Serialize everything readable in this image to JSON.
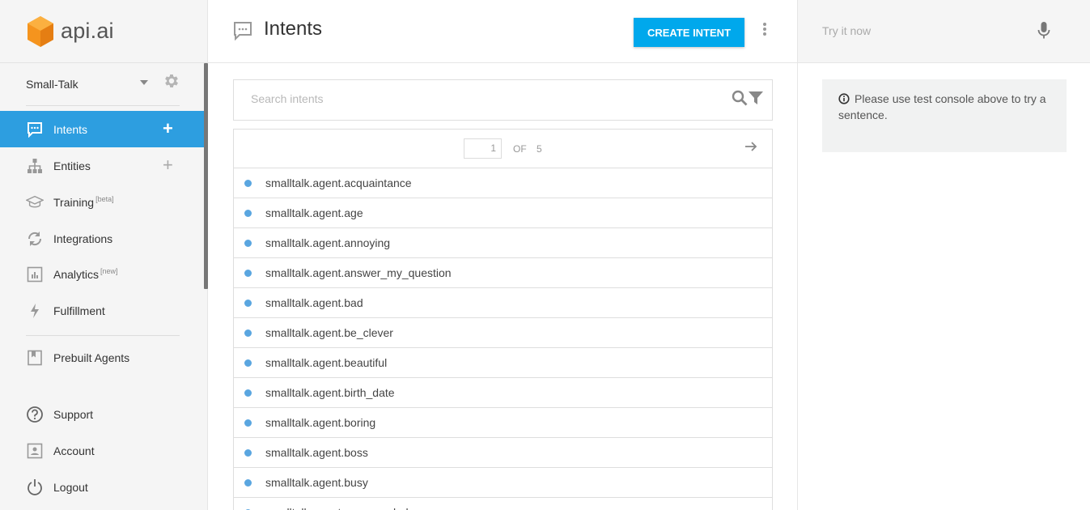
{
  "brand": {
    "name": "api.ai",
    "logo_color": "#f5941e"
  },
  "agent": {
    "name": "Small-Talk"
  },
  "sidebar": {
    "items": [
      {
        "label": "Intents",
        "icon": "chat-icon",
        "active": true,
        "has_add": true
      },
      {
        "label": "Entities",
        "icon": "hierarchy-icon",
        "has_add": true
      },
      {
        "label": "Training",
        "tag": "[beta]",
        "icon": "graduation-cap-icon"
      },
      {
        "label": "Integrations",
        "icon": "sync-icon"
      },
      {
        "label": "Analytics",
        "tag": "[new]",
        "icon": "bar-chart-icon"
      },
      {
        "label": "Fulfillment",
        "icon": "lightning-icon"
      },
      {
        "label": "Prebuilt Agents",
        "icon": "book-icon"
      },
      {
        "label": "Support",
        "icon": "help-circle-icon"
      },
      {
        "label": "Account",
        "icon": "user-card-icon"
      },
      {
        "label": "Logout",
        "icon": "power-icon"
      }
    ]
  },
  "header": {
    "title": "Intents",
    "create_label": "CREATE INTENT"
  },
  "search": {
    "placeholder": "Search intents"
  },
  "pagination": {
    "current": "1",
    "of_label": "OF",
    "total": "5"
  },
  "intents": [
    "smalltalk.agent.acquaintance",
    "smalltalk.agent.age",
    "smalltalk.agent.annoying",
    "smalltalk.agent.answer_my_question",
    "smalltalk.agent.bad",
    "smalltalk.agent.be_clever",
    "smalltalk.agent.beautiful",
    "smalltalk.agent.birth_date",
    "smalltalk.agent.boring",
    "smalltalk.agent.boss",
    "smalltalk.agent.busy",
    "smalltalk.agent.can_you_help"
  ],
  "try_panel": {
    "placeholder": "Try it now",
    "info_text": "Please use test console above to try a sentence."
  },
  "colors": {
    "accent": "#2d9ee0",
    "button": "#00a8ec",
    "intent_dot": "#5aa6e0"
  }
}
